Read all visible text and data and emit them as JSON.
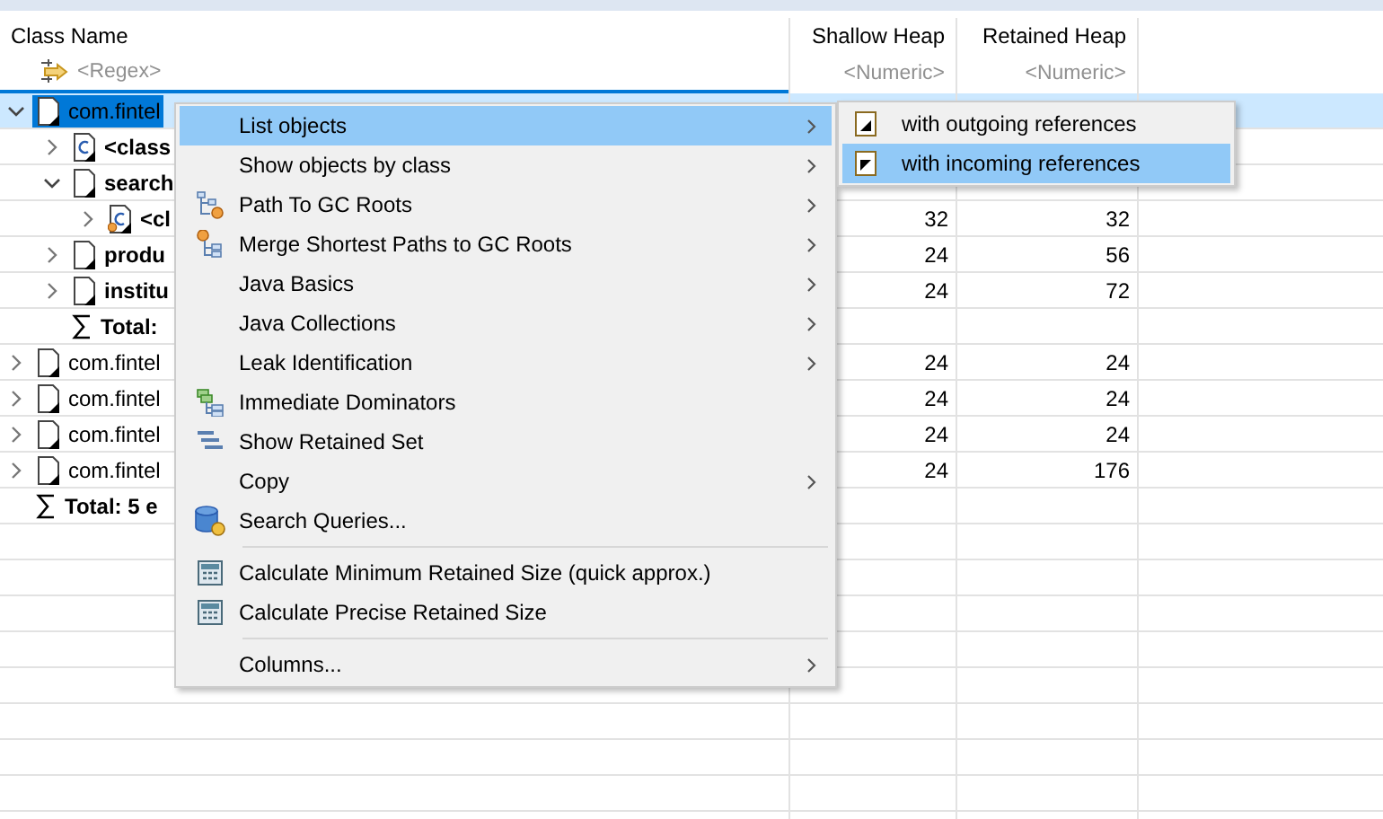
{
  "table": {
    "columns": [
      {
        "title": "Class Name",
        "filter": "<Regex>"
      },
      {
        "title": "Shallow Heap",
        "filter": "<Numeric>"
      },
      {
        "title": "Retained Heap",
        "filter": "<Numeric>"
      }
    ],
    "rows": [
      {
        "name": "com.fintel",
        "kind": "file",
        "bold": false,
        "expanded": true,
        "selected": true,
        "children": [
          {
            "name": "<class",
            "kind": "class",
            "bold": true,
            "expanded": false,
            "selected": false
          },
          {
            "name": "search",
            "kind": "file",
            "bold": true,
            "expanded": true,
            "selected": false,
            "children": [
              {
                "name": "<cl",
                "kind": "class-ref",
                "bold": true,
                "expanded": false,
                "selected": false,
                "shallow": "32",
                "retained": "32"
              }
            ]
          },
          {
            "name": "produ",
            "kind": "file",
            "bold": true,
            "expanded": false,
            "selected": false,
            "shallow": "24",
            "retained": "56"
          },
          {
            "name": "institu",
            "kind": "file",
            "bold": true,
            "expanded": false,
            "selected": false,
            "shallow": "24",
            "retained": "72"
          },
          {
            "name": "Total:",
            "kind": "sum",
            "bold": true,
            "selected": false
          }
        ]
      },
      {
        "name": "com.fintel",
        "kind": "file",
        "bold": false,
        "expanded": false,
        "selected": false,
        "shallow": "24",
        "retained": "24"
      },
      {
        "name": "com.fintel",
        "kind": "file",
        "bold": false,
        "expanded": false,
        "selected": false,
        "shallow": "24",
        "retained": "24"
      },
      {
        "name": "com.fintel",
        "kind": "file",
        "bold": false,
        "expanded": false,
        "selected": false,
        "shallow": "24",
        "retained": "24"
      },
      {
        "name": "com.fintel",
        "kind": "file",
        "bold": false,
        "expanded": false,
        "selected": false,
        "shallow": "24",
        "retained": "176"
      },
      {
        "name": "Total: 5 e",
        "kind": "sum",
        "bold": true,
        "selected": false
      }
    ]
  },
  "context_menu": {
    "items": [
      {
        "kind": "plain",
        "label": "List objects",
        "submenu": true,
        "selected": true
      },
      {
        "kind": "plain",
        "label": "Show objects by class",
        "submenu": true,
        "selected": false
      },
      {
        "kind": "path",
        "label": "Path To GC Roots",
        "submenu": true,
        "selected": false
      },
      {
        "kind": "merge",
        "label": "Merge Shortest Paths to GC Roots",
        "submenu": true,
        "selected": false
      },
      {
        "kind": "plain",
        "label": "Java Basics",
        "submenu": true,
        "selected": false
      },
      {
        "kind": "plain",
        "label": "Java Collections",
        "submenu": true,
        "selected": false
      },
      {
        "kind": "plain",
        "label": "Leak Identification",
        "submenu": true,
        "selected": false
      },
      {
        "kind": "dominators",
        "label": "Immediate Dominators",
        "submenu": false,
        "selected": false
      },
      {
        "kind": "retained",
        "label": "Show Retained Set",
        "submenu": false,
        "selected": false
      },
      {
        "kind": "plain",
        "label": "Copy",
        "submenu": true,
        "selected": false
      },
      {
        "kind": "database",
        "label": "Search Queries...",
        "submenu": false,
        "selected": false
      },
      {
        "kind": "separator"
      },
      {
        "kind": "calculator",
        "label": "Calculate Minimum Retained Size (quick approx.)",
        "submenu": false,
        "selected": false
      },
      {
        "kind": "calculator",
        "label": "Calculate Precise Retained Size",
        "submenu": false,
        "selected": false
      },
      {
        "kind": "separator"
      },
      {
        "kind": "plain",
        "label": "Columns...",
        "submenu": true,
        "selected": false
      }
    ]
  },
  "submenu": {
    "items": [
      {
        "label": "with outgoing references",
        "kind": "outgoing",
        "selected": false
      },
      {
        "label": "with incoming references",
        "kind": "incoming",
        "selected": true
      }
    ]
  }
}
